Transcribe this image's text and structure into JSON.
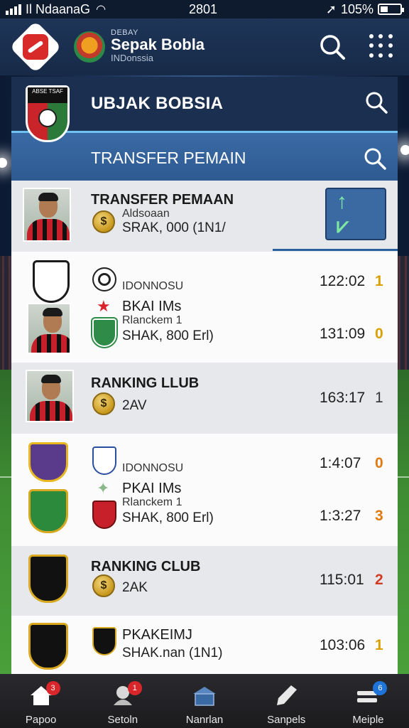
{
  "status_bar": {
    "carrier": "Il NdaanaG",
    "time": "2801",
    "battery": "105%"
  },
  "app_header": {
    "brand_small": "DEBAY",
    "brand_title": "Sepak Bobla",
    "brand_subtitle": "INDonssia",
    "crest_label": "ABSE TSAF"
  },
  "club_panel": {
    "title": "UBJAK BOBSIA"
  },
  "transfer_panel": {
    "title": "TRANSFER PEMAIN"
  },
  "card_transfer": {
    "title": "TRANSFER PEMAAN",
    "line1": "Aldsoaan",
    "line2": "SRAK, 000  (1N1/",
    "button_label": "↑ ⩗"
  },
  "card_match1": {
    "line1": "IDONNOSU",
    "line2": "BKAI IMs",
    "line3": "Rlanckem 1",
    "line4": "SHAK, 800  Erl)",
    "time1": "122:02",
    "score1": "1",
    "time2": "131:09",
    "score2": "0"
  },
  "card_ranking1": {
    "title": "RANKING LLUB",
    "value": "2AV",
    "time": "163:17",
    "score": "1"
  },
  "card_match2": {
    "line1": "IDONNOSU",
    "line2": "PKAI IMs",
    "line3": "Rlanckem 1",
    "line4": "SHAK, 800  Erl)",
    "time1": "1:4:07",
    "score1": "0",
    "time2": "1:3:27",
    "score2": "3"
  },
  "card_ranking2": {
    "title": "RANKING CLUB",
    "value": "2AK",
    "time": "115:01",
    "score": "2"
  },
  "card_player": {
    "title": "PKAKEIMJ",
    "subtitle": "SHAK.nan  (1N1)",
    "time": "103:06",
    "score": "1"
  },
  "bottom_nav": {
    "items": [
      {
        "label": "Papoo",
        "icon": "home-icon",
        "badge": "3"
      },
      {
        "label": "Setoln",
        "icon": "team-icon",
        "badge": "1"
      },
      {
        "label": "Nanrlan",
        "icon": "stadium-icon",
        "badge": ""
      },
      {
        "label": "Sanpels",
        "icon": "boot-icon",
        "badge": ""
      },
      {
        "label": "Meiple",
        "icon": "profile-icon",
        "badge": "6"
      }
    ]
  },
  "colors": {
    "header_bg": "#1b2f50",
    "accent_blue": "#3a6aa4",
    "score_yellow": "#d8a000",
    "score_red": "#d23a22"
  }
}
